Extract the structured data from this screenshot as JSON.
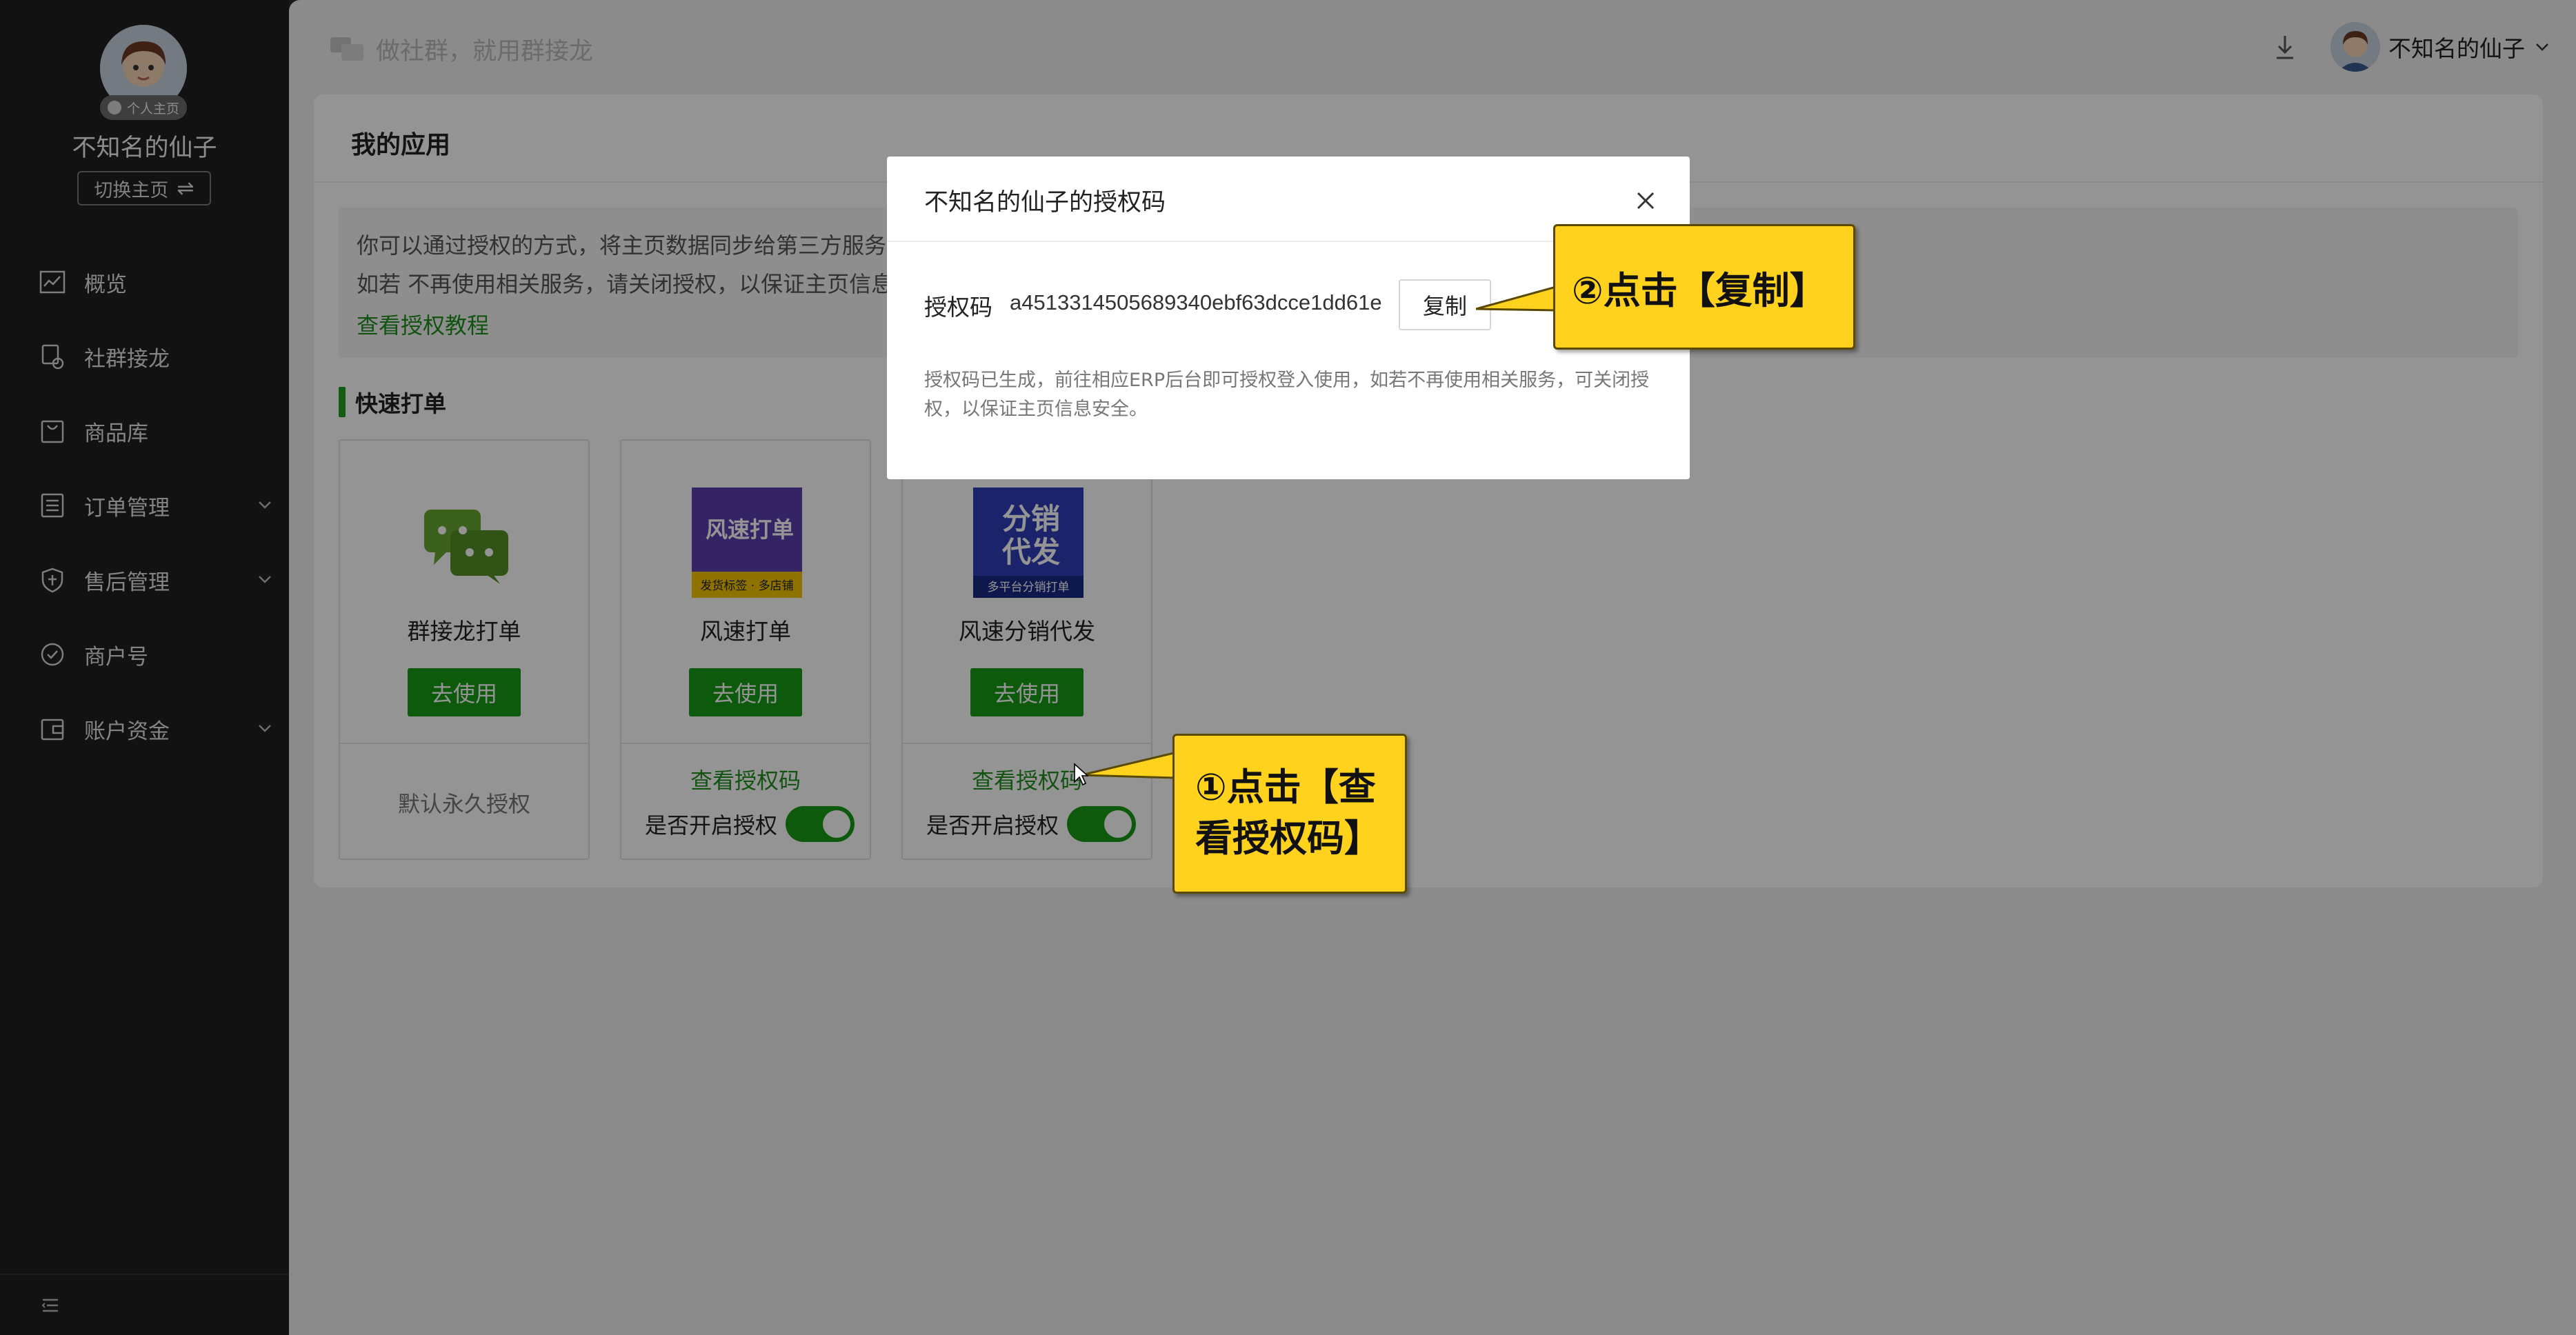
{
  "sidebar": {
    "badge": "个人主页",
    "username": "不知名的仙子",
    "switch_label": "切换主页",
    "menu": [
      {
        "label": "概览",
        "icon": "chart-icon",
        "has_children": false
      },
      {
        "label": "社群接龙",
        "icon": "relay-icon",
        "has_children": false
      },
      {
        "label": "商品库",
        "icon": "bag-icon",
        "has_children": false
      },
      {
        "label": "订单管理",
        "icon": "list-icon",
        "has_children": true
      },
      {
        "label": "售后管理",
        "icon": "shield-icon",
        "has_children": true
      },
      {
        "label": "商户号",
        "icon": "merchant-icon",
        "has_children": false
      },
      {
        "label": "账户资金",
        "icon": "wallet-icon",
        "has_children": true
      }
    ]
  },
  "topbar": {
    "slogan": "做社群，就用群接龙",
    "username": "不知名的仙子"
  },
  "panel": {
    "title": "我的应用",
    "notice_line1": "你可以通过授权的方式，将主页数据同步给第三方服务，",
    "notice_line2": "如若 不再使用相关服务，请关闭授权，以保证主页信息",
    "tutorial_link": "查看授权教程",
    "section_title": "快速打单",
    "apps": [
      {
        "name": "群接龙打单",
        "use_label": "去使用",
        "permission": "默认永久授权"
      },
      {
        "name": "风速打单",
        "use_label": "去使用",
        "view_code": "查看授权码",
        "toggle_label": "是否开启授权",
        "enabled": true
      },
      {
        "name": "风速分销代发",
        "use_label": "去使用",
        "view_code": "查看授权码",
        "toggle_label": "是否开启授权",
        "enabled": true
      }
    ],
    "logo_text": {
      "fengsu_title": "风速打单",
      "fengsu_tags": "发货标签 · 多店铺",
      "fenxiao_line1": "分销",
      "fenxiao_line2": "代发",
      "fenxiao_sub": "多平台分销打单"
    }
  },
  "modal": {
    "title": "不知名的仙子的授权码",
    "code_label": "授权码",
    "code_value": "a4513314505689340ebf63dcce1dd61e",
    "copy_label": "复制",
    "description": "授权码已生成，前往相应ERP后台即可授权登入使用，如若不再使用相关服务，可关闭授权，以保证主页信息安全。"
  },
  "callouts": {
    "step1_line1": "①点击【查",
    "step1_line2": "看授权码】",
    "step2": "②点击【复制】"
  },
  "colors": {
    "accent_green": "#179b17",
    "link_green": "#1f8f1f",
    "sidebar_bg": "#1f1f1f",
    "callout_yellow": "#ffd21e"
  }
}
